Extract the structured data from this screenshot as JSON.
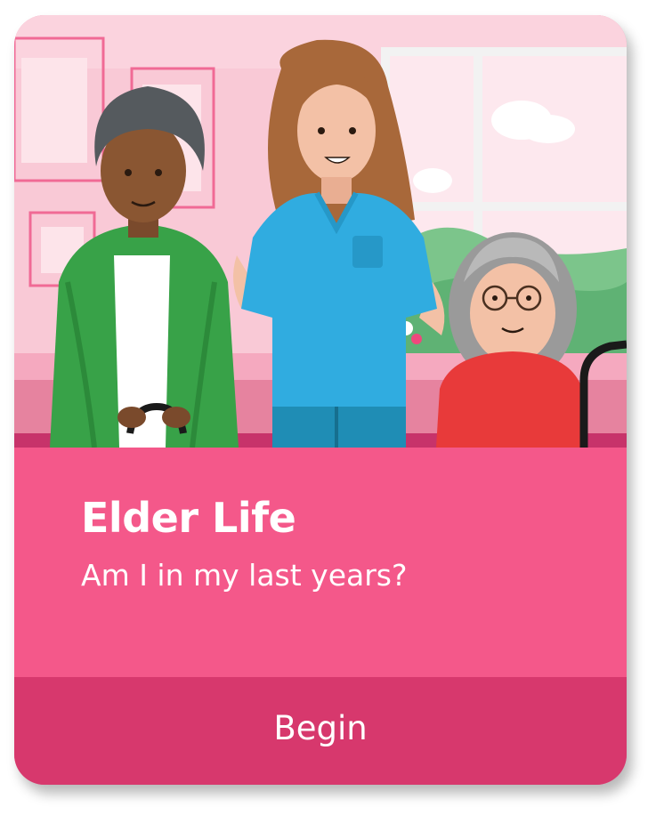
{
  "card": {
    "title": "Elder Life",
    "subtitle": "Am I in my last years?",
    "begin_label": "Begin"
  },
  "colors": {
    "card_pink": "#f4588a",
    "button_pink": "#d7386d",
    "wall_pink": "#f9c9d6",
    "nurse_blue": "#2faee0",
    "cardigan_green": "#3aa34a",
    "sweater_red": "#e83a3a"
  }
}
